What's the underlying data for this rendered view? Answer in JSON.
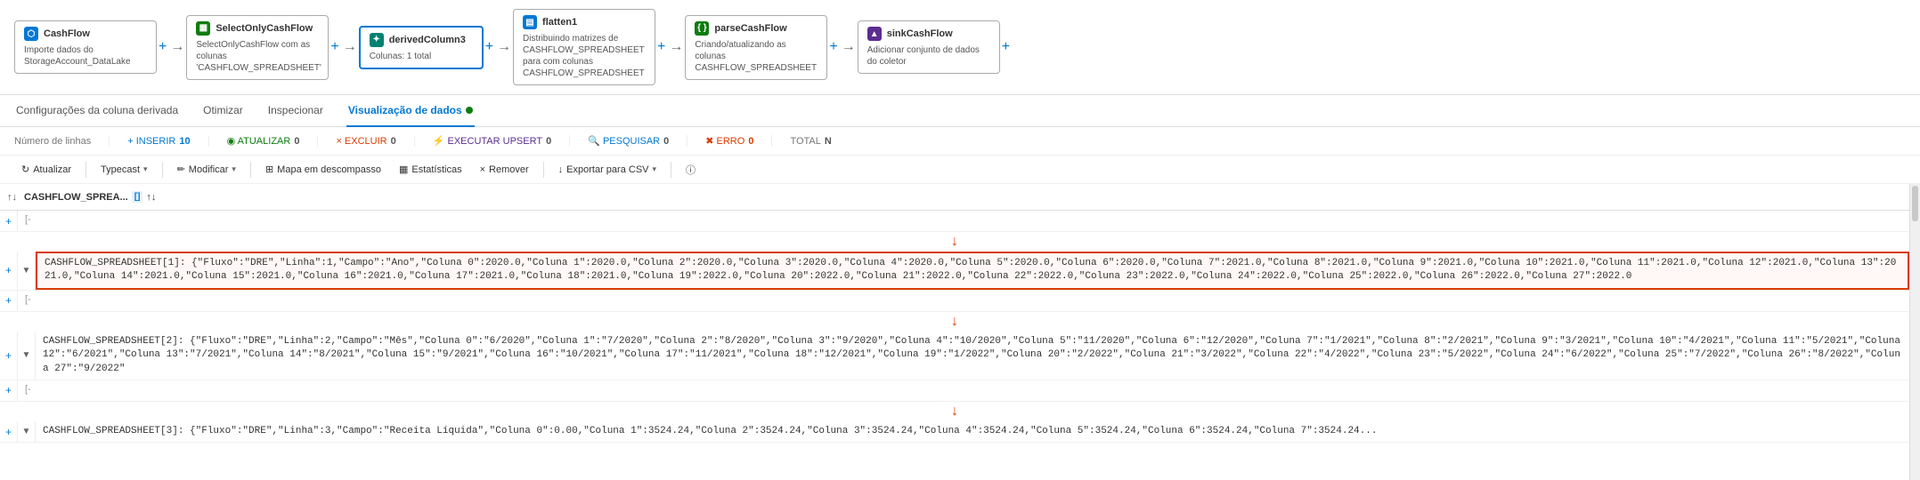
{
  "pipeline": {
    "nodes": [
      {
        "id": "cashflow",
        "label": "CashFlow",
        "icon": "blue",
        "iconText": "⬡",
        "desc": "Importe dados do StorageAccount_DataLake",
        "active": false
      },
      {
        "id": "selectonly",
        "label": "SelectOnlyCashFlow",
        "icon": "green",
        "iconText": "▦",
        "desc": "SelectOnlyCashFlow com as colunas 'CASHFLOW_SPREADSHEET'",
        "active": false
      },
      {
        "id": "derived",
        "label": "derivedColumn3",
        "icon": "teal",
        "iconText": "✦",
        "desc": "Colunas: 1 total",
        "active": true
      },
      {
        "id": "flatten",
        "label": "flatten1",
        "icon": "blue",
        "iconText": "▤",
        "desc": "Distribuindo matrizes de CASHFLOW_SPREADSHEET para  com colunas CASHFLOW_SPREADSHEET",
        "active": false
      },
      {
        "id": "parse",
        "label": "parseCashFlow",
        "icon": "green",
        "iconText": "{ }",
        "desc": "Criando/atualizando as colunas CASHFLOW_SPREADSHEET",
        "active": false
      },
      {
        "id": "sink",
        "label": "sinkCashFlow",
        "icon": "purple",
        "iconText": "▲",
        "desc": "Adicionar conjunto de dados do coletor",
        "active": false
      }
    ]
  },
  "tabs": [
    {
      "id": "config",
      "label": "Configurações da coluna derivada",
      "active": false
    },
    {
      "id": "otimizar",
      "label": "Otimizar",
      "active": false
    },
    {
      "id": "inspecionar",
      "label": "Inspecionar",
      "active": false
    },
    {
      "id": "visualization",
      "label": "Visualização de dados",
      "active": true
    },
    {
      "id": "dot_status",
      "label": ""
    }
  ],
  "stats": {
    "row_label": "Número de linhas",
    "insert_label": "+ INSERIR",
    "insert_value": "10",
    "update_label": "◉ ATUALIZAR",
    "update_value": "0",
    "delete_label": "× EXCLUIR",
    "delete_value": "0",
    "upsert_label": "⚡ EXECUTAR UPSERT",
    "upsert_value": "0",
    "search_label": "🔍 PESQUISAR",
    "search_value": "0",
    "error_label": "✖ ERRO",
    "error_value": "0",
    "total_label": "TOTAL",
    "total_value": "N"
  },
  "toolbar": {
    "refresh_label": "↻ Atualizar",
    "typecast_label": "Typecast",
    "modify_label": "Modificar",
    "map_label": "Mapa em descompasso",
    "stats_label": "Estatísticas",
    "remove_label": "Remover",
    "export_label": "↓ Exportar para CSV",
    "info_label": "ⓘ"
  },
  "grid": {
    "column_header": "CASHFLOW_SPREA...",
    "column_type": "[] ↑↓",
    "rows": [
      {
        "id": "row1",
        "prefix": "[-",
        "content": "",
        "expanded": false
      },
      {
        "id": "row2",
        "prefix": "[-",
        "content": "CASHFLOW_SPREADSHEET[1]: {\"Fluxo\":\"DRE\",\"Linha\":1,\"Campo\":\"Ano\",\"Coluna 0\":2020.0,\"Coluna 1\":2020.0,\"Coluna 2\":2020.0,\"Coluna 3\":2020.0,\"Coluna 4\":2020.0,\"Coluna 5\":2020.0,\"Coluna 6\":2020.0,\"Coluna 7\":2021.0,\"Coluna 8\":2021.0,\"Coluna 9\":2021.0,\"Coluna 10\":2021.0,\"Coluna 11\":2021.0,\"Coluna 12\":2021.0,\"Coluna 13\":2021.0,\"Coluna 14\":2021.0,\"Coluna 15\":2021.0,\"Coluna 16\":2021.0,\"Coluna 17\":2021.0,\"Coluna 18\":2021.0,\"Coluna 19\":2022.0,\"Coluna 20\":2022.0,\"Coluna 21\":2022.0,\"Coluna 22\":2022.0,\"Coluna 23\":2022.0,\"Coluna 24\":2022.0,\"Coluna 25\":2022.0,\"Coluna 26\":2022.0,\"Coluna 27\":2022.0",
        "expanded": true,
        "highlighted": true
      },
      {
        "id": "row3",
        "prefix": "[-",
        "content": "",
        "expanded": false
      },
      {
        "id": "row4",
        "prefix": "[-",
        "content": "CASHFLOW_SPREADSHEET[2]: {\"Fluxo\":\"DRE\",\"Linha\":2,\"Campo\":\"Mês\",\"Coluna 0\":\"6/2020\",\"Coluna 1\":\"7/2020\",\"Coluna 2\":\"8/2020\",\"Coluna 3\":\"9/2020\",\"Coluna 4\":\"10/2020\",\"Coluna 5\":\"11/2020\",\"Coluna 6\":\"12/2020\",\"Coluna 7\":\"1/2021\",\"Coluna 8\":\"2/2021\",\"Coluna 9\":\"3/2021\",\"Coluna 10\":\"4/2021\",\"Coluna 11\":\"5/2021\",\"Coluna 12\":\"6/2021\",\"Coluna 13\":\"7/2021\",\"Coluna 14\":\"8/2021\",\"Coluna 15\":\"9/2021\",\"Coluna 16\":\"10/2021\",\"Coluna 17\":\"11/2021\",\"Coluna 18\":\"12/2021\",\"Coluna 19\":\"1/2022\",\"Coluna 20\":\"2/2022\",\"Coluna 21\":\"3/2022\",\"Coluna 22\":\"4/2022\",\"Coluna 23\":\"5/2022\",\"Coluna 24\":\"6/2022\",\"Coluna 25\":\"7/2022\",\"Coluna 26\":\"8/2022\",\"Coluna 27\":\"9/2022\"",
        "expanded": true,
        "highlighted": false
      },
      {
        "id": "row5",
        "prefix": "[-",
        "content": "",
        "expanded": false
      },
      {
        "id": "row6",
        "prefix": "[-",
        "content": "CASHFLOW_SPREADSHEET[3]: {\"Fluxo\":\"DRE\",\"Linha\":3,\"Campo\":\"Receita Líquida\",\"Coluna 0\":0.00,\"Coluna 1\":3524.24,\"Coluna 2\":3524.24,\"Coluna 3\":3524.24,\"Coluna 4\":3524.24,\"Coluna 5\":3524.24,\"Coluna 6\":3524.24,\"Coluna 7\":3524.24...",
        "expanded": true,
        "highlighted": false
      }
    ],
    "red_arrow_rows": [
      1,
      3,
      5
    ]
  }
}
